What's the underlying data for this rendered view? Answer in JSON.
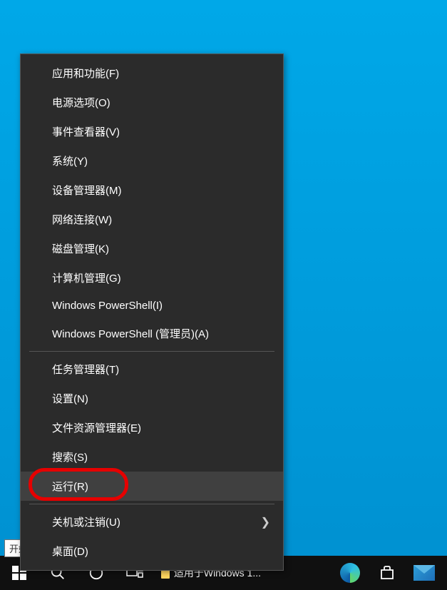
{
  "menu": {
    "group1": [
      "应用和功能(F)",
      "电源选项(O)",
      "事件查看器(V)",
      "系统(Y)",
      "设备管理器(M)",
      "网络连接(W)",
      "磁盘管理(K)",
      "计算机管理(G)",
      "Windows PowerShell(I)",
      "Windows PowerShell (管理员)(A)"
    ],
    "group2": [
      "任务管理器(T)",
      "设置(N)",
      "文件资源管理器(E)",
      "搜索(S)",
      "运行(R)"
    ],
    "group3_submenu": "关机或注销(U)",
    "group3_last": "桌面(D)"
  },
  "tooltip": "开始",
  "taskbar": {
    "running_app": "适用于Windows 1..."
  }
}
